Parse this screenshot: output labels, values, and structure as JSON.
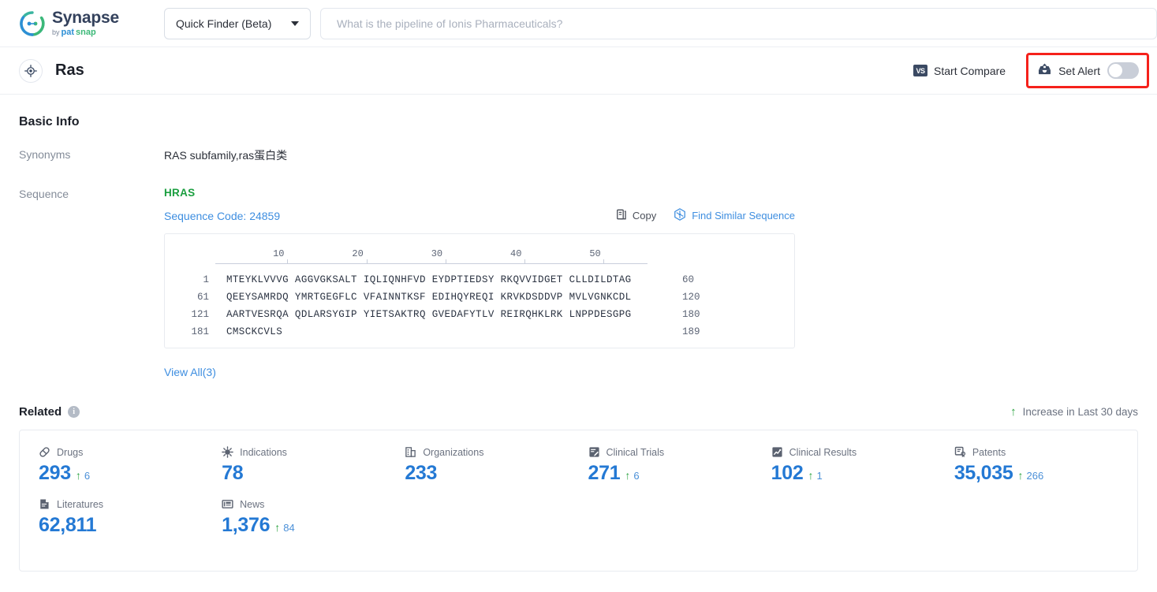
{
  "brand": {
    "name": "Synapse",
    "by": "by",
    "pat": "pat",
    "snap": "snap"
  },
  "topbar": {
    "finder_label": "Quick Finder (Beta)",
    "search_placeholder": "What is the pipeline of Ionis Pharmaceuticals?",
    "search_value": ""
  },
  "entity": {
    "title": "Ras",
    "compare_label": "Start Compare",
    "compare_badge": "VS",
    "alert_label": "Set Alert",
    "alert_on": false,
    "highlight_color": "#f5211b"
  },
  "basic_info": {
    "heading": "Basic Info",
    "synonyms_label": "Synonyms",
    "synonyms_value": "RAS subfamily,ras蛋白类",
    "sequence_label": "Sequence",
    "sequence_name": "HRAS",
    "sequence_code": "Sequence Code: 24859",
    "copy_label": "Copy",
    "similar_label": "Find Similar Sequence",
    "view_all_label": "View All(3)",
    "ruler_ticks": [
      "10",
      "20",
      "30",
      "40",
      "50"
    ],
    "sequence_rows": [
      {
        "start": "1",
        "chunks": "MTEYKLVVVG AGGVGKSALT IQLIQNHFVD EYDPTIEDSY RKQVVIDGET CLLDILDTAG",
        "end": "60"
      },
      {
        "start": "61",
        "chunks": "QEEYSAMRDQ YMRTGEGFLC VFAINNTKSF EDIHQYREQI KRVKDSDDVP MVLVGNKCDL",
        "end": "120"
      },
      {
        "start": "121",
        "chunks": "AARTVESRQA QDLARSYGIP YIETSAKTRQ GVEDAFYTLV REIRQHKLRK LNPPDESGPG",
        "end": "180"
      },
      {
        "start": "181",
        "chunks": "CMSCKCVLS",
        "end": "189"
      }
    ]
  },
  "related": {
    "heading": "Related",
    "info_glyph": "i",
    "increase_note": "Increase in Last 30 days",
    "up_arrow": "↑",
    "stats": [
      {
        "icon": "pill-icon",
        "label": "Drugs",
        "value": "293",
        "delta": "6"
      },
      {
        "icon": "virus-icon",
        "label": "Indications",
        "value": "78",
        "delta": ""
      },
      {
        "icon": "building-icon",
        "label": "Organizations",
        "value": "233",
        "delta": ""
      },
      {
        "icon": "clinical-trial-icon",
        "label": "Clinical Trials",
        "value": "271",
        "delta": "6"
      },
      {
        "icon": "clinical-result-icon",
        "label": "Clinical Results",
        "value": "102",
        "delta": "1"
      },
      {
        "icon": "patent-icon",
        "label": "Patents",
        "value": "35,035",
        "delta": "266"
      },
      {
        "icon": "literature-icon",
        "label": "Literatures",
        "value": "62,811",
        "delta": ""
      },
      {
        "icon": "news-icon",
        "label": "News",
        "value": "1,376",
        "delta": "84"
      }
    ]
  }
}
